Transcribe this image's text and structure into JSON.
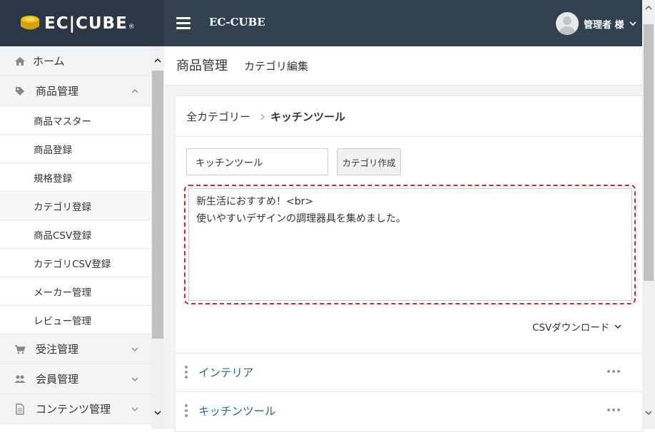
{
  "header": {
    "logo_text": "EC|CUBE",
    "logo_mark": "®",
    "site_name": "EC-CUBE",
    "user_name": "管理者 様"
  },
  "sidebar": {
    "items": [
      {
        "label": "ホーム",
        "icon": "home-icon"
      },
      {
        "label": "商品管理",
        "icon": "tag-icon",
        "expanded": true
      },
      {
        "label": "商品マスター"
      },
      {
        "label": "商品登録"
      },
      {
        "label": "規格登録"
      },
      {
        "label": "カテゴリ登録",
        "active": true
      },
      {
        "label": "商品CSV登録"
      },
      {
        "label": "カテゴリCSV登録"
      },
      {
        "label": "メーカー管理"
      },
      {
        "label": "レビュー管理"
      },
      {
        "label": "受注管理",
        "icon": "cart-icon"
      },
      {
        "label": "会員管理",
        "icon": "users-icon"
      },
      {
        "label": "コンテンツ管理",
        "icon": "file-icon"
      }
    ]
  },
  "page": {
    "title": "商品管理",
    "subtitle": "カテゴリ編集"
  },
  "breadcrumb": {
    "root": "全カテゴリー",
    "current": "キッチンツール"
  },
  "form": {
    "name_value": "キッチンツール",
    "create_button": "カテゴリ作成",
    "description_value": "新生活におすすめ！<br>\n使いやすいデザインの調理器具を集めました。"
  },
  "csv_download": "CSVダウンロード",
  "categories": [
    {
      "name": "インテリア"
    },
    {
      "name": "キッチンツール"
    }
  ],
  "colors": {
    "header_bg": "#32414f",
    "logo_bg": "#2b3744",
    "link": "#2a6496",
    "highlight_border": "#e0271f",
    "logo_cube": "#f1c40f"
  }
}
